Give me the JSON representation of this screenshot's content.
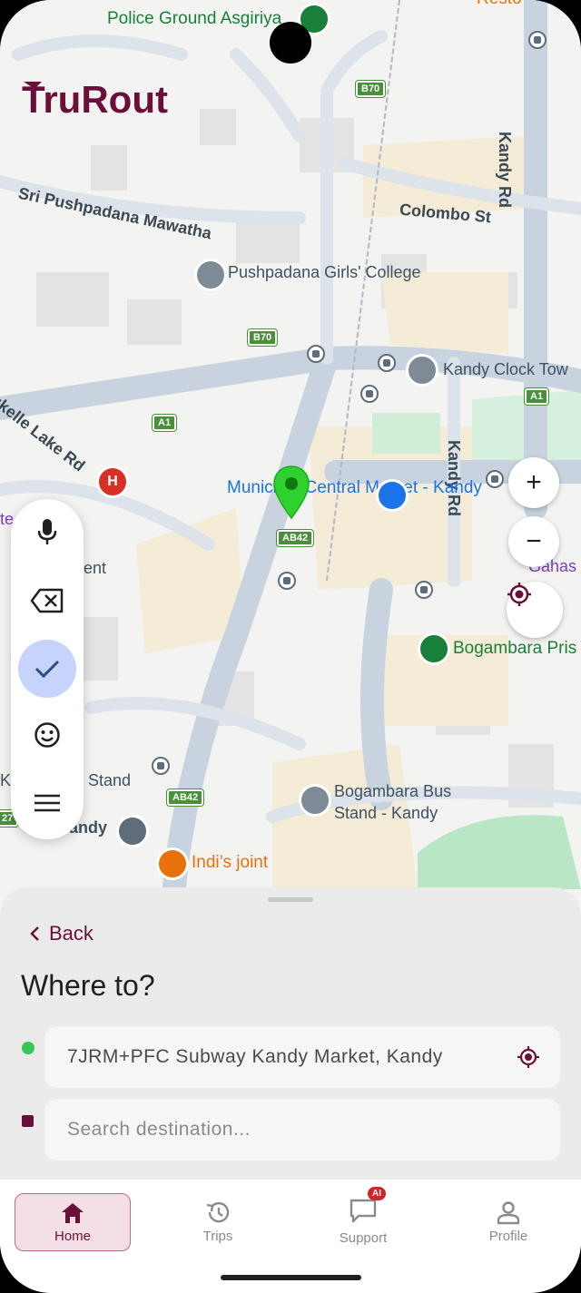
{
  "app": {
    "brand": "TruRout"
  },
  "map": {
    "labels": {
      "police": "Police Ground Asgiriya",
      "sri_pushpadana": "Sri Pushpadana Mawatha",
      "pushpadana": "Pushpadana Girls' College",
      "colombo_st": "Colombo St",
      "kandy_rd_top": "Kandy Rd",
      "kandy_rd_mid": "Kandy Rd",
      "clock_tower": "Kandy Clock Tow",
      "lake_rd": "ukelle Lake Rd",
      "municipal_market": "Municipal Central Market - Kandy",
      "gahas": "Gahas",
      "bogambara_prison": "Bogambara Pris",
      "bus_stand": "Bogambara Bus Stand - Kandy",
      "indis_joint": "Indi’s joint",
      "k_stand": "Stand",
      "kandy_partial": "andy",
      "ent_partial": "ent",
      "te_partial": "te",
      "k_partial": "K",
      "s27": "27",
      "top_partial": "Resto"
    },
    "shields": {
      "b70_top": "B70",
      "b70_mid": "B70",
      "a1_left": "A1",
      "a1_right": "A1",
      "ab42_mid": "AB42",
      "ab42_bottom": "AB42"
    },
    "controls": {
      "zoom_in": "+",
      "zoom_out": "−"
    }
  },
  "keyboard_toolbar": {
    "items": [
      "microphone",
      "backspace",
      "check",
      "emoji",
      "menu"
    ]
  },
  "sheet": {
    "back_label": "Back",
    "title": "Where to?",
    "origin_value": "7JRM+PFC Subway Kandy Market, Kandy",
    "destination_placeholder": "Search destination...",
    "origin_dot_color": "#34c759",
    "destination_dot_color": "#6b0f3a"
  },
  "bottom_nav": {
    "items": [
      {
        "label": "Home",
        "icon": "home-icon",
        "active": true
      },
      {
        "label": "Trips",
        "icon": "history-icon",
        "active": false
      },
      {
        "label": "Support",
        "icon": "chat-icon",
        "active": false,
        "badge": "AI"
      },
      {
        "label": "Profile",
        "icon": "person-icon",
        "active": false
      }
    ]
  },
  "colors": {
    "brand": "#6b0f3a",
    "active_nav_bg": "#f3dfe5",
    "pin": "#2fd12f"
  }
}
